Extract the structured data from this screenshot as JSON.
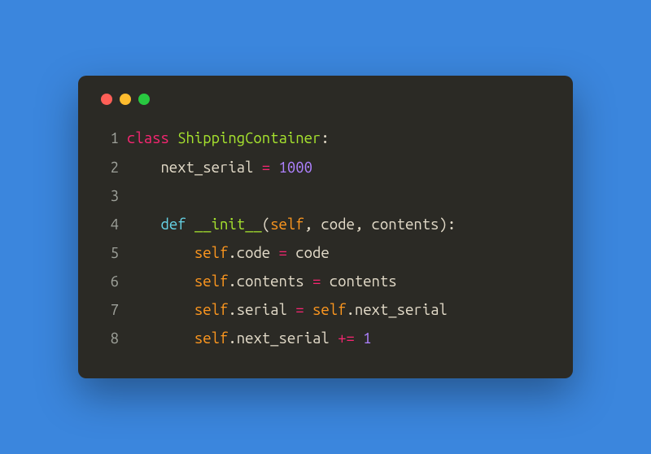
{
  "window": {
    "buttons": [
      "close",
      "minimize",
      "zoom"
    ]
  },
  "code": {
    "lines": [
      {
        "num": "1",
        "tokens": [
          {
            "t": "class",
            "c": "tok-kw-red"
          },
          {
            "t": " ",
            "c": "tok-default"
          },
          {
            "t": "ShippingContainer",
            "c": "tok-class"
          },
          {
            "t": ":",
            "c": "tok-default"
          }
        ]
      },
      {
        "num": "2",
        "tokens": [
          {
            "t": "    next_serial ",
            "c": "tok-default"
          },
          {
            "t": "=",
            "c": "tok-op"
          },
          {
            "t": " ",
            "c": "tok-default"
          },
          {
            "t": "1000",
            "c": "tok-num"
          }
        ]
      },
      {
        "num": "3",
        "tokens": []
      },
      {
        "num": "4",
        "tokens": [
          {
            "t": "    ",
            "c": "tok-default"
          },
          {
            "t": "def",
            "c": "tok-kw-blue"
          },
          {
            "t": " ",
            "c": "tok-default"
          },
          {
            "t": "__init__",
            "c": "tok-func"
          },
          {
            "t": "(",
            "c": "tok-default"
          },
          {
            "t": "self",
            "c": "tok-self"
          },
          {
            "t": ", code, contents):",
            "c": "tok-default"
          }
        ]
      },
      {
        "num": "5",
        "tokens": [
          {
            "t": "        ",
            "c": "tok-default"
          },
          {
            "t": "self",
            "c": "tok-self"
          },
          {
            "t": ".",
            "c": "tok-default"
          },
          {
            "t": "code",
            "c": "tok-default"
          },
          {
            "t": " ",
            "c": "tok-default"
          },
          {
            "t": "=",
            "c": "tok-op"
          },
          {
            "t": " code",
            "c": "tok-default"
          }
        ]
      },
      {
        "num": "6",
        "tokens": [
          {
            "t": "        ",
            "c": "tok-default"
          },
          {
            "t": "self",
            "c": "tok-self"
          },
          {
            "t": ".",
            "c": "tok-default"
          },
          {
            "t": "contents",
            "c": "tok-default"
          },
          {
            "t": " ",
            "c": "tok-default"
          },
          {
            "t": "=",
            "c": "tok-op"
          },
          {
            "t": " contents",
            "c": "tok-default"
          }
        ]
      },
      {
        "num": "7",
        "tokens": [
          {
            "t": "        ",
            "c": "tok-default"
          },
          {
            "t": "self",
            "c": "tok-self"
          },
          {
            "t": ".",
            "c": "tok-default"
          },
          {
            "t": "serial",
            "c": "tok-default"
          },
          {
            "t": " ",
            "c": "tok-default"
          },
          {
            "t": "=",
            "c": "tok-op"
          },
          {
            "t": " ",
            "c": "tok-default"
          },
          {
            "t": "self",
            "c": "tok-self"
          },
          {
            "t": ".next_serial",
            "c": "tok-default"
          }
        ]
      },
      {
        "num": "8",
        "tokens": [
          {
            "t": "        ",
            "c": "tok-default"
          },
          {
            "t": "self",
            "c": "tok-self"
          },
          {
            "t": ".",
            "c": "tok-default"
          },
          {
            "t": "next_serial",
            "c": "tok-default"
          },
          {
            "t": " ",
            "c": "tok-default"
          },
          {
            "t": "+=",
            "c": "tok-op"
          },
          {
            "t": " ",
            "c": "tok-default"
          },
          {
            "t": "1",
            "c": "tok-num"
          }
        ]
      }
    ]
  }
}
